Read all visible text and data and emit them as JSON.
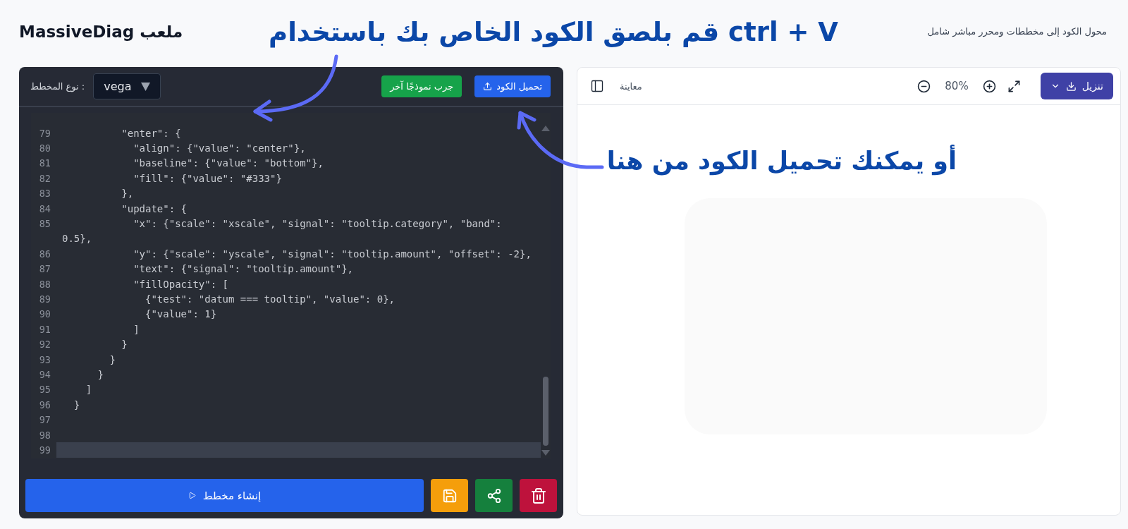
{
  "header": {
    "title": "MassiveDiag ملعب",
    "subtitle": "محول الكود إلى مخططات ومحرر مباشر شامل"
  },
  "annotations": [
    {
      "kind": "paste",
      "text": "قم بلصق الكود الخاص بك باستخدام ctrl + V"
    },
    {
      "kind": "upload",
      "text": "أو يمكنك تحميل الكود من هنا"
    }
  ],
  "editor": {
    "type_label": "نوع المخطط :",
    "type_value": "vega",
    "buttons": [
      {
        "kind": "upload",
        "label": "تحميل الكود"
      },
      {
        "kind": "sample",
        "label": "جرب نموذجًا آخر"
      }
    ],
    "lines": [
      {
        "number": "79",
        "text": "          \"enter\": {",
        "current": false
      },
      {
        "number": "80",
        "text": "            \"align\": {\"value\": \"center\"},",
        "current": false
      },
      {
        "number": "81",
        "text": "            \"baseline\": {\"value\": \"bottom\"},",
        "current": false
      },
      {
        "number": "82",
        "text": "            \"fill\": {\"value\": \"#333\"}",
        "current": false
      },
      {
        "number": "83",
        "text": "          },",
        "current": false
      },
      {
        "number": "84",
        "text": "          \"update\": {",
        "current": false
      },
      {
        "number": "85",
        "text": "            \"x\": {\"scale\": \"xscale\", \"signal\": \"tooltip.category\", \"band\":",
        "current": false
      },
      {
        "text": "0.5},",
        "current": false
      },
      {
        "number": "86",
        "text": "            \"y\": {\"scale\": \"yscale\", \"signal\": \"tooltip.amount\", \"offset\": -2},",
        "current": false
      },
      {
        "number": "87",
        "text": "            \"text\": {\"signal\": \"tooltip.amount\"},",
        "current": false
      },
      {
        "number": "88",
        "text": "            \"fillOpacity\": [",
        "current": false
      },
      {
        "number": "89",
        "text": "              {\"test\": \"datum === tooltip\", \"value\": 0},",
        "current": false
      },
      {
        "number": "90",
        "text": "              {\"value\": 1}",
        "current": false
      },
      {
        "number": "91",
        "text": "            ]",
        "current": false
      },
      {
        "number": "92",
        "text": "          }",
        "current": false
      },
      {
        "number": "93",
        "text": "        }",
        "current": false
      },
      {
        "number": "94",
        "text": "      }",
        "current": false
      },
      {
        "number": "95",
        "text": "    ]",
        "current": false
      },
      {
        "number": "96",
        "text": "  }",
        "current": false
      },
      {
        "number": "97",
        "current": false
      },
      {
        "number": "98",
        "current": false
      },
      {
        "number": "99",
        "current": true
      }
    ],
    "actions": [
      {
        "kind": "generate",
        "label": "إنشاء مخطط"
      },
      {
        "kind": "save"
      },
      {
        "kind": "share"
      },
      {
        "kind": "delete"
      }
    ]
  },
  "preview": {
    "title": "معاينة",
    "zoom": "80%",
    "download_label": "تنزيل"
  }
}
